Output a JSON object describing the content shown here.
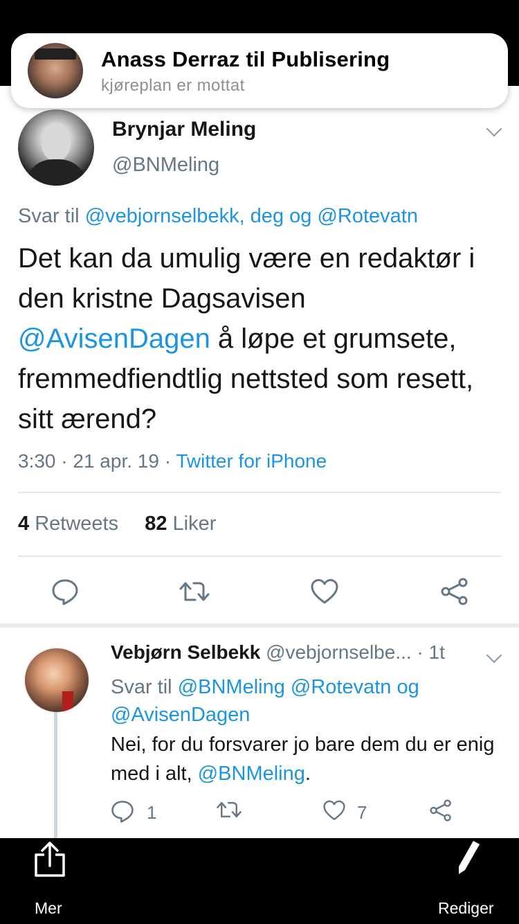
{
  "notification": {
    "title": "Anass Derraz til Publisering",
    "subtitle": "kjøreplan er mottat"
  },
  "tweet": {
    "name": "Brynjar Meling",
    "handle": "@BNMeling",
    "reply_prefix": "Svar til ",
    "reply_targets": "@vebjornselbekk, deg og @Rotevatn",
    "text_part1": "Det kan da umulig være en redaktør i den kristne Dagsavisen ",
    "text_mention": "@AvisenDagen",
    "text_part2": " å løpe et grumsete, fremmedfiendtlig nettsted som resett, sitt ærend?",
    "timestamp": "3:30 · 21 apr. 19 · ",
    "source": "Twitter for iPhone",
    "retweets_count": "4",
    "retweets_label": " Retweets",
    "likes_count": "82",
    "likes_label": " Liker"
  },
  "reply": {
    "name": "Vebjørn Selbekk",
    "handle": " @vebjornselbe...",
    "time": " · 1t",
    "reply_prefix": "Svar til ",
    "reply_targets": "@BNMeling @Rotevatn og @AvisenDagen",
    "text_part1": "Nei, for du forsvarer jo bare dem du er enig med i alt, ",
    "text_mention": "@BNMeling",
    "text_part2": ".",
    "replies_count": "1",
    "likes_count": "7"
  },
  "bottom_bar": {
    "share_label": "Mer",
    "edit_label": "Rediger"
  },
  "colors": {
    "link": "#1b95e0",
    "text": "#14171a",
    "muted": "#657786"
  }
}
